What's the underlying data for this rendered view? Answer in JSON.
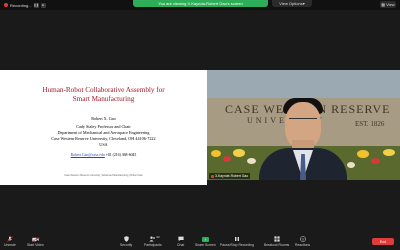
{
  "top_bar": {
    "recording_label": "Recording...",
    "banner": "You are viewing X Kaynda-Robert Gao's screen",
    "view_options": "View Options",
    "view": "View"
  },
  "slide": {
    "title_line1": "Human-Robot Collaborative Assembly for",
    "title_line2": "Smart Manufacturing",
    "presenter": "Robert X. Gao",
    "role": "Cady Staley Professor and Chair",
    "department": "Department of Mechanical and Aerospace Engineering",
    "university": "Case Western Reserve University, Cleveland, OH 44106-7222",
    "country": "USA",
    "email": "Robert.Gao@case.edu",
    "phone": "+01 (216) 368-6045",
    "footer": "Case Western Reserve University  |  Advanced Manufacturing  |  Robert Gao"
  },
  "camera": {
    "wall_text_line1": "CASE WESTERN RESERVE",
    "wall_text_line2": "UNIVERSITY",
    "wall_est": "EST. 1826",
    "participant_name": "3-Kaynde-Robert Gao"
  },
  "toolbar": {
    "items": [
      {
        "label": "Unmute",
        "icon": "microphone-icon"
      },
      {
        "label": "Start Video",
        "icon": "video-camera-icon"
      },
      {
        "label": "Security",
        "icon": "shield-icon"
      },
      {
        "label": "Participants",
        "icon": "participants-icon",
        "count": "62"
      },
      {
        "label": "Chat",
        "icon": "chat-icon"
      },
      {
        "label": "Share Screen",
        "icon": "share-screen-icon"
      },
      {
        "label": "Pause/Stop Recording",
        "icon": "recording-icon"
      },
      {
        "label": "Breakout Rooms",
        "icon": "breakout-rooms-icon"
      },
      {
        "label": "Reactions",
        "icon": "reactions-icon"
      }
    ],
    "end_label": "End"
  },
  "colors": {
    "banner_green": "#2fae5a",
    "end_red": "#e23b3b",
    "slide_title": "#a0182a"
  }
}
